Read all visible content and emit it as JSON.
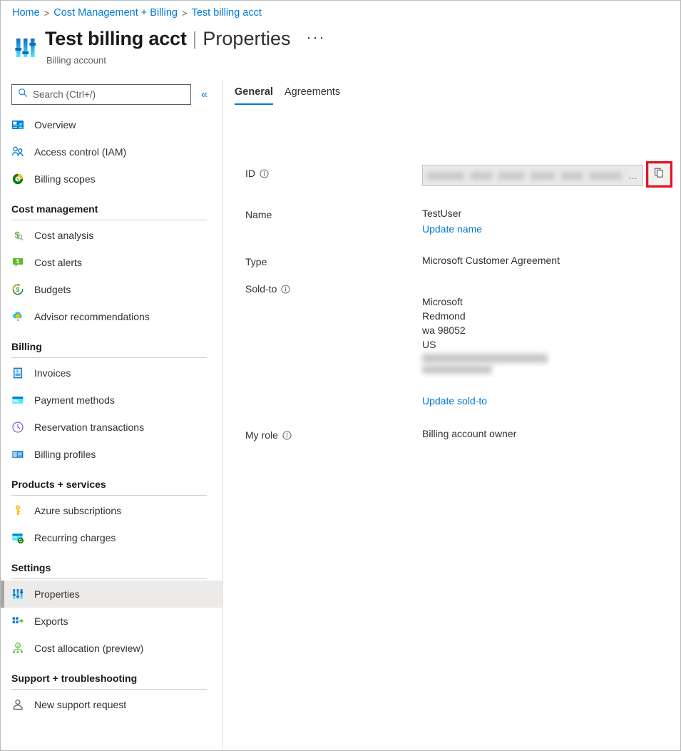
{
  "breadcrumb": {
    "items": [
      "Home",
      "Cost Management + Billing",
      "Test billing acct"
    ],
    "separator": ">"
  },
  "header": {
    "icon": "properties-sliders-icon",
    "title": "Test billing acct",
    "divider": "|",
    "page": "Properties",
    "subtitle": "Billing account",
    "more_menu": "···"
  },
  "sidebar": {
    "search": {
      "placeholder": "Search (Ctrl+/)",
      "value": "",
      "icon": "search-icon"
    },
    "collapse": {
      "icon": "chevron-double-left-icon",
      "glyph": "«"
    },
    "top_items": [
      {
        "label": "Overview",
        "icon": "overview-icon"
      },
      {
        "label": "Access control (IAM)",
        "icon": "access-control-icon"
      },
      {
        "label": "Billing scopes",
        "icon": "billing-scopes-icon"
      }
    ],
    "groups": [
      {
        "title": "Cost management",
        "items": [
          {
            "label": "Cost analysis",
            "icon": "cost-analysis-icon"
          },
          {
            "label": "Cost alerts",
            "icon": "cost-alerts-icon"
          },
          {
            "label": "Budgets",
            "icon": "budgets-icon"
          },
          {
            "label": "Advisor recommendations",
            "icon": "advisor-recommendations-icon"
          }
        ]
      },
      {
        "title": "Billing",
        "items": [
          {
            "label": "Invoices",
            "icon": "invoices-icon"
          },
          {
            "label": "Payment methods",
            "icon": "payment-methods-icon"
          },
          {
            "label": "Reservation transactions",
            "icon": "reservation-transactions-icon"
          },
          {
            "label": "Billing profiles",
            "icon": "billing-profiles-icon"
          }
        ]
      },
      {
        "title": "Products + services",
        "items": [
          {
            "label": "Azure subscriptions",
            "icon": "azure-subscriptions-key-icon"
          },
          {
            "label": "Recurring charges",
            "icon": "recurring-charges-icon"
          }
        ]
      },
      {
        "title": "Settings",
        "items": [
          {
            "label": "Properties",
            "icon": "properties-sliders-icon",
            "selected": true
          },
          {
            "label": "Exports",
            "icon": "exports-icon"
          },
          {
            "label": "Cost allocation (preview)",
            "icon": "cost-allocation-icon"
          }
        ]
      },
      {
        "title": "Support + troubleshooting",
        "items": [
          {
            "label": "New support request",
            "icon": "support-person-icon"
          }
        ]
      }
    ]
  },
  "main": {
    "tabs": [
      {
        "label": "General",
        "active": true
      },
      {
        "label": "Agreements",
        "active": false
      }
    ],
    "properties": {
      "id": {
        "label": "ID",
        "info_icon": "info-icon",
        "value": "",
        "redacted": true,
        "overflow_ellipsis": "…",
        "copy_button": {
          "icon": "copy-icon",
          "highlighted": true,
          "highlight_color": "#e81123"
        }
      },
      "name": {
        "label": "Name",
        "value": "TestUser",
        "link": "Update name"
      },
      "type": {
        "label": "Type",
        "value": "Microsoft Customer Agreement"
      },
      "sold_to": {
        "label": "Sold-to",
        "info_icon": "info-icon",
        "lines": [
          "Microsoft",
          "Redmond",
          "wa 98052",
          "US"
        ],
        "redacted_lines": 2,
        "link": "Update sold-to"
      },
      "my_role": {
        "label": "My role",
        "info_icon": "info-icon",
        "value": "Billing account owner"
      }
    }
  },
  "colors": {
    "accent": "#0078d4",
    "link": "#0078d4",
    "highlight": "#e81123",
    "text": "#323130",
    "selected_bg": "#edebe9"
  }
}
